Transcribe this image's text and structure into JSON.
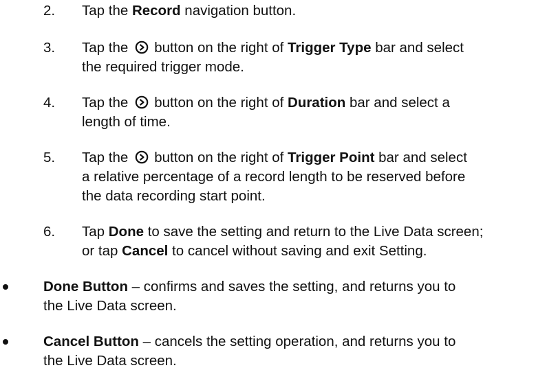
{
  "steps": [
    {
      "num": "2.",
      "pre": "Tap the ",
      "bold": "Record",
      "post": " navigation button."
    },
    {
      "num": "3.",
      "pre": "Tap the",
      "post_icon": "button on the right of ",
      "bold": "Trigger Type",
      "post": " bar and select",
      "line2": "the required trigger mode."
    },
    {
      "num": "4.",
      "pre": "Tap the",
      "post_icon": "button on the right of ",
      "bold": "Duration",
      "post": " bar and select a",
      "line2": "length of time."
    },
    {
      "num": "5.",
      "pre": "Tap the",
      "post_icon": "button on the right of ",
      "bold": "Trigger Point",
      "post": " bar and select",
      "line2": "a relative percentage of a record length to be reserved before",
      "line3": "the data recording start point."
    },
    {
      "num": "6.",
      "pre": "Tap ",
      "bold": "Done",
      "post": " to save the setting and return to the Live Data screen;",
      "line2_pre": "or tap ",
      "line2_bold": "Cancel",
      "line2_post": " to cancel without saving and exit Setting."
    }
  ],
  "bullets": [
    {
      "bold": "Done Button",
      "text": " – confirms and saves the setting, and returns you to",
      "line2": "the Live Data screen."
    },
    {
      "bold": "Cancel Button",
      "text": " – cancels the setting operation, and returns you to",
      "line2": "the Live Data screen."
    }
  ],
  "icons": {
    "circle_arrow": "circle-chevron-right-icon"
  }
}
